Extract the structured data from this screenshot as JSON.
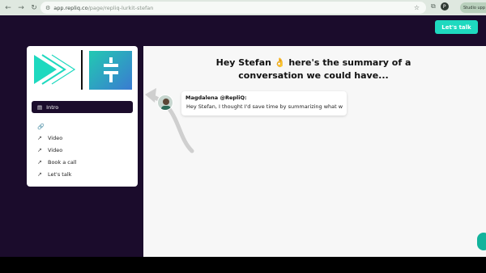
{
  "browser": {
    "back_icon": "arrow-left-icon",
    "forward_icon": "arrow-right-icon",
    "reload_icon": "reload-icon",
    "url_host": "app.repliq.co",
    "url_path": "/page/repliq-lurkit-stefan",
    "profile_letter": "P",
    "update_label": "Studio upp"
  },
  "header": {
    "cta_label": "Let's talk"
  },
  "sidebar": {
    "active_item": "Intro",
    "items": [
      {
        "label": "Video"
      },
      {
        "label": "Video"
      },
      {
        "label": "Book a call"
      },
      {
        "label": "Let's talk"
      }
    ]
  },
  "main": {
    "headline_line1": "Hey Stefan 👌 here's the summary of a",
    "headline_line2": "conversation we could have...",
    "sender": "Magdalena @RepliQ:",
    "message": "Hey Stefan, I thought I'd save time by summarizing what we"
  },
  "colors": {
    "page_bg": "#1b0c2c",
    "accent": "#1ed9bf"
  }
}
